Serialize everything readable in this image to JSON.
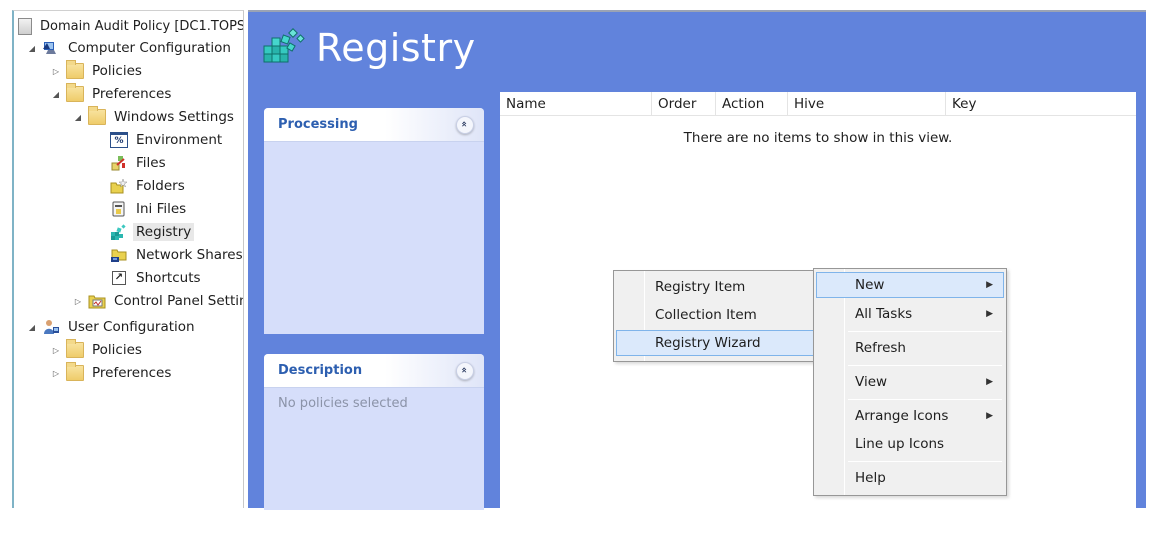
{
  "tree": {
    "root": "Domain Audit Policy [DC1.TOPS",
    "items": [
      {
        "label": "Computer Configuration",
        "state": "expanded",
        "icon": "computer-config-icon"
      },
      {
        "label": "Policies",
        "state": "collapsed",
        "icon": "folder-icon"
      },
      {
        "label": "Preferences",
        "state": "expanded",
        "icon": "folder-icon"
      },
      {
        "label": "Windows Settings",
        "state": "expanded",
        "icon": "folder-icon"
      },
      {
        "label": "Environment",
        "icon": "environment-icon"
      },
      {
        "label": "Files",
        "icon": "files-icon"
      },
      {
        "label": "Folders",
        "icon": "folders-icon"
      },
      {
        "label": "Ini Files",
        "icon": "ini-files-icon"
      },
      {
        "label": "Registry",
        "icon": "registry-icon",
        "selected": true
      },
      {
        "label": "Network Shares",
        "icon": "network-shares-icon"
      },
      {
        "label": "Shortcuts",
        "icon": "shortcuts-icon"
      },
      {
        "label": "Control Panel Settings",
        "state": "collapsed",
        "icon": "control-panel-icon"
      },
      {
        "label": "User Configuration",
        "state": "expanded",
        "icon": "user-config-icon"
      },
      {
        "label": "Policies",
        "state": "collapsed",
        "icon": "folder-icon"
      },
      {
        "label": "Preferences",
        "state": "collapsed",
        "icon": "folder-icon"
      }
    ]
  },
  "main": {
    "title": "Registry",
    "processing": {
      "heading": "Processing",
      "collapse": "»"
    },
    "description": {
      "heading": "Description",
      "collapse": "»",
      "text": "No policies selected"
    },
    "list": {
      "columns": [
        "Name",
        "Order",
        "Action",
        "Hive",
        "Key"
      ],
      "empty_message": "There are no items to show in this view."
    }
  },
  "context_menu": {
    "items": [
      {
        "label": "New",
        "submenu": true,
        "highlighted": true
      },
      {
        "label": "All Tasks",
        "submenu": true
      },
      {
        "label": "Refresh"
      },
      {
        "label": "View",
        "submenu": true
      },
      {
        "label": "Arrange Icons",
        "submenu": true
      },
      {
        "label": "Line up Icons"
      },
      {
        "label": "Help"
      }
    ],
    "arrow": "▶"
  },
  "submenu": {
    "items": [
      {
        "label": "Registry Item"
      },
      {
        "label": "Collection Item"
      },
      {
        "label": "Registry Wizard",
        "highlighted": true
      }
    ]
  },
  "colors": {
    "panel_blue": "#6183dc",
    "box_fill": "#d6defa",
    "heading_blue": "#2d5fb0",
    "menu_highlight": "#dbe9fb",
    "menu_highlight_border": "#7fb4ea"
  }
}
